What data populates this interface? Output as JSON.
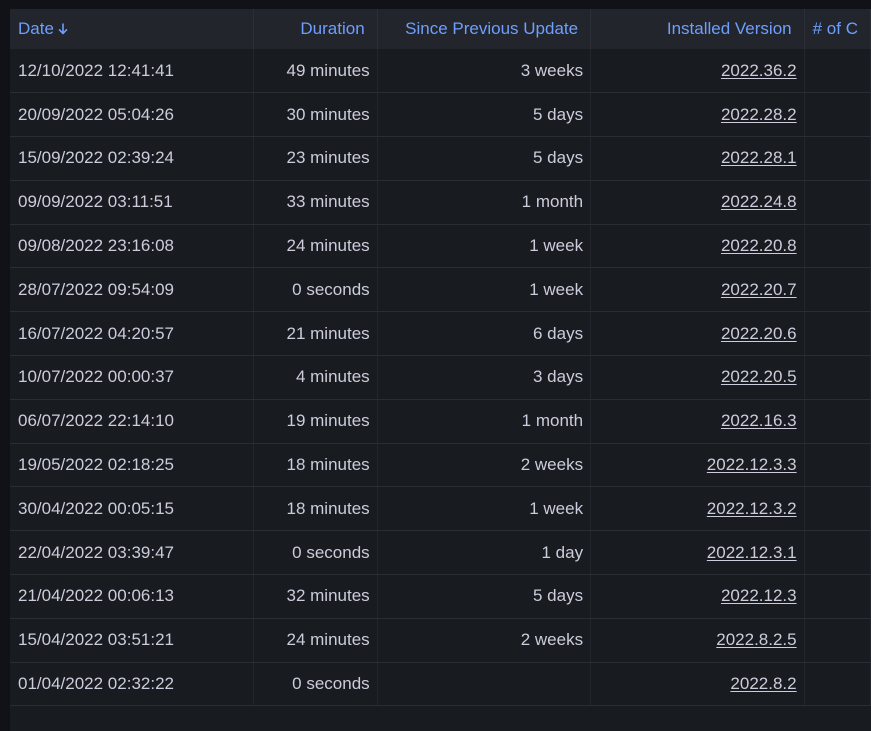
{
  "columns": {
    "date": "Date",
    "duration": "Duration",
    "since": "Since Previous Update",
    "version": "Installed Version",
    "count": "# of C"
  },
  "rows": [
    {
      "date": "12/10/2022 12:41:41",
      "duration": "49 minutes",
      "since": "3 weeks",
      "version": "2022.36.2"
    },
    {
      "date": "20/09/2022 05:04:26",
      "duration": "30 minutes",
      "since": "5 days",
      "version": "2022.28.2"
    },
    {
      "date": "15/09/2022 02:39:24",
      "duration": "23 minutes",
      "since": "5 days",
      "version": "2022.28.1"
    },
    {
      "date": "09/09/2022 03:11:51",
      "duration": "33 minutes",
      "since": "1 month",
      "version": "2022.24.8"
    },
    {
      "date": "09/08/2022 23:16:08",
      "duration": "24 minutes",
      "since": "1 week",
      "version": "2022.20.8"
    },
    {
      "date": "28/07/2022 09:54:09",
      "duration": "0 seconds",
      "since": "1 week",
      "version": "2022.20.7"
    },
    {
      "date": "16/07/2022 04:20:57",
      "duration": "21 minutes",
      "since": "6 days",
      "version": "2022.20.6"
    },
    {
      "date": "10/07/2022 00:00:37",
      "duration": "4 minutes",
      "since": "3 days",
      "version": "2022.20.5"
    },
    {
      "date": "06/07/2022 22:14:10",
      "duration": "19 minutes",
      "since": "1 month",
      "version": "2022.16.3"
    },
    {
      "date": "19/05/2022 02:18:25",
      "duration": "18 minutes",
      "since": "2 weeks",
      "version": "2022.12.3.3"
    },
    {
      "date": "30/04/2022 00:05:15",
      "duration": "18 minutes",
      "since": "1 week",
      "version": "2022.12.3.2"
    },
    {
      "date": "22/04/2022 03:39:47",
      "duration": "0 seconds",
      "since": "1 day",
      "version": "2022.12.3.1"
    },
    {
      "date": "21/04/2022 00:06:13",
      "duration": "32 minutes",
      "since": "5 days",
      "version": "2022.12.3"
    },
    {
      "date": "15/04/2022 03:51:21",
      "duration": "24 minutes",
      "since": "2 weeks",
      "version": "2022.8.2.5"
    },
    {
      "date": "01/04/2022 02:32:22",
      "duration": "0 seconds",
      "since": "",
      "version": "2022.8.2"
    }
  ],
  "sort": {
    "column": "date",
    "direction": "descending",
    "icon": "arrow-down-icon"
  },
  "colors": {
    "header_text": "#6e9fff",
    "cell_text": "#ccccdc",
    "panel_bg": "#181b1f",
    "header_bg": "#22252b",
    "page_bg": "#111217"
  }
}
